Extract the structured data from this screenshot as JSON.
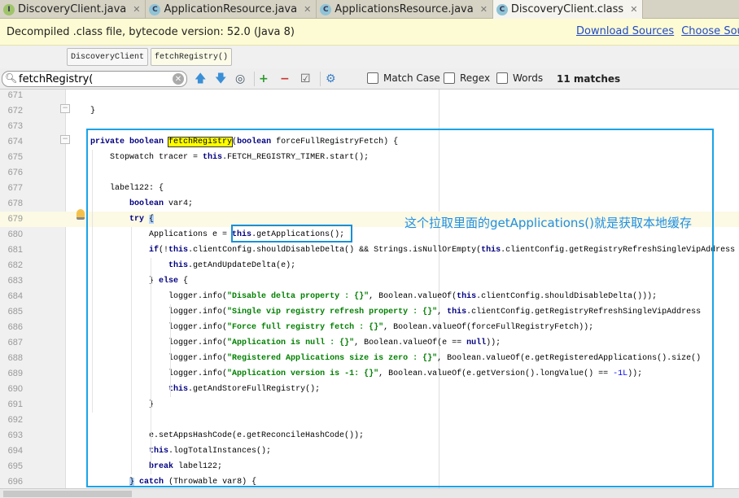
{
  "tabs": [
    {
      "label": "DiscoveryClient.java",
      "icon": "I",
      "type": "interface"
    },
    {
      "label": "ApplicationResource.java",
      "icon": "C",
      "type": "class"
    },
    {
      "label": "ApplicationsResource.java",
      "icon": "C",
      "type": "class"
    },
    {
      "label": "DiscoveryClient.class",
      "icon": "C",
      "type": "class",
      "active": true
    }
  ],
  "banner": {
    "text": "Decompiled .class file, bytecode version: 52.0 (Java 8)",
    "download_sources": "Download Sources",
    "choose_sources": "Choose Sourc"
  },
  "breadcrumb": [
    "DiscoveryClient",
    "fetchRegistry()"
  ],
  "search": {
    "value": "fetchRegistry(",
    "match_case": "Match Case",
    "regex": "Regex",
    "words": "Words",
    "matches": "11 matches"
  },
  "annotation": "这个拉取里面的getApplications()就是获取本地缓存",
  "colors": {
    "keyword": "#000080",
    "string": "#008000",
    "number": "#0000ff",
    "annotation_box": "#1aa3e8",
    "highlight": "#ffff00"
  },
  "code": [
    {
      "n": "671",
      "i": 0,
      "t": []
    },
    {
      "n": "672",
      "i": 1,
      "t": [
        [
          "}",
          ""
        ]
      ]
    },
    {
      "n": "673",
      "i": 0,
      "t": []
    },
    {
      "n": "674",
      "i": 1,
      "t": [
        [
          "private boolean ",
          "kw"
        ],
        [
          "fetchRegistry",
          "hl"
        ],
        [
          "(",
          ""
        ],
        [
          "boolean ",
          "kw"
        ],
        [
          "forceFullRegistryFetch) {",
          ""
        ]
      ]
    },
    {
      "n": "675",
      "i": 2,
      "t": [
        [
          "Stopwatch tracer = ",
          ""
        ],
        [
          "this",
          "kw"
        ],
        [
          ".FETCH_REGISTRY_TIMER.start();",
          ""
        ]
      ]
    },
    {
      "n": "676",
      "i": 0,
      "t": []
    },
    {
      "n": "677",
      "i": 2,
      "t": [
        [
          "label122: {",
          ""
        ]
      ]
    },
    {
      "n": "678",
      "i": 3,
      "t": [
        [
          "boolean ",
          "kw"
        ],
        [
          "var4;",
          ""
        ]
      ]
    },
    {
      "n": "679",
      "i": 3,
      "t": [
        [
          "try ",
          "kw"
        ],
        [
          "{",
          "caret"
        ]
      ],
      "cur": true
    },
    {
      "n": "680",
      "i": 4,
      "t": [
        [
          "Applications e = ",
          ""
        ],
        [
          "this",
          "kw"
        ],
        [
          ".getApplications();",
          ""
        ]
      ]
    },
    {
      "n": "681",
      "i": 4,
      "t": [
        [
          "if",
          "kw"
        ],
        [
          "(!",
          ""
        ],
        [
          "this",
          "kw"
        ],
        [
          ".clientConfig.shouldDisableDelta() && Strings.isNullOrEmpty(",
          ""
        ],
        [
          "this",
          "kw"
        ],
        [
          ".clientConfig.getRegistryRefreshSingleVipAddress",
          ""
        ]
      ]
    },
    {
      "n": "682",
      "i": 5,
      "t": [
        [
          "this",
          "kw"
        ],
        [
          ".getAndUpdateDelta(e);",
          ""
        ]
      ]
    },
    {
      "n": "683",
      "i": 4,
      "t": [
        [
          "} ",
          ""
        ],
        [
          "else ",
          "kw"
        ],
        [
          "{",
          ""
        ]
      ]
    },
    {
      "n": "684",
      "i": 5,
      "t": [
        [
          "logger.info(",
          ""
        ],
        [
          "\"Disable delta property : {}\"",
          "str"
        ],
        [
          ", Boolean.valueOf(",
          ""
        ],
        [
          "this",
          "kw"
        ],
        [
          ".clientConfig.shouldDisableDelta()));",
          ""
        ]
      ]
    },
    {
      "n": "685",
      "i": 5,
      "t": [
        [
          "logger.info(",
          ""
        ],
        [
          "\"Single vip registry refresh property : {}\"",
          "str"
        ],
        [
          ", ",
          ""
        ],
        [
          "this",
          "kw"
        ],
        [
          ".clientConfig.getRegistryRefreshSingleVipAddress",
          ""
        ]
      ]
    },
    {
      "n": "686",
      "i": 5,
      "t": [
        [
          "logger.info(",
          ""
        ],
        [
          "\"Force full registry fetch : {}\"",
          "str"
        ],
        [
          ", Boolean.valueOf(forceFullRegistryFetch));",
          ""
        ]
      ]
    },
    {
      "n": "687",
      "i": 5,
      "t": [
        [
          "logger.info(",
          ""
        ],
        [
          "\"Application is null : {}\"",
          "str"
        ],
        [
          ", Boolean.valueOf(e == ",
          ""
        ],
        [
          "null",
          "kw"
        ],
        [
          "));",
          ""
        ]
      ]
    },
    {
      "n": "688",
      "i": 5,
      "t": [
        [
          "logger.info(",
          ""
        ],
        [
          "\"Registered Applications size is zero : {}\"",
          "str"
        ],
        [
          ", Boolean.valueOf(e.getRegisteredApplications().size()",
          ""
        ]
      ]
    },
    {
      "n": "689",
      "i": 5,
      "t": [
        [
          "logger.info(",
          ""
        ],
        [
          "\"Application version is -1: {}\"",
          "str"
        ],
        [
          ", Boolean.valueOf(e.getVersion().longValue() == ",
          ""
        ],
        [
          "-1L",
          "num"
        ],
        [
          "));",
          ""
        ]
      ]
    },
    {
      "n": "690",
      "i": 5,
      "t": [
        [
          "this",
          "kw"
        ],
        [
          ".getAndStoreFullRegistry();",
          ""
        ]
      ]
    },
    {
      "n": "691",
      "i": 4,
      "t": [
        [
          "}",
          ""
        ]
      ]
    },
    {
      "n": "692",
      "i": 0,
      "t": []
    },
    {
      "n": "693",
      "i": 4,
      "t": [
        [
          "e.setAppsHashCode(e.getReconcileHashCode());",
          ""
        ]
      ]
    },
    {
      "n": "694",
      "i": 4,
      "t": [
        [
          "this",
          "kw"
        ],
        [
          ".logTotalInstances();",
          ""
        ]
      ]
    },
    {
      "n": "695",
      "i": 4,
      "t": [
        [
          "break ",
          "kw"
        ],
        [
          "label122;",
          ""
        ]
      ]
    },
    {
      "n": "696",
      "i": 3,
      "t": [
        [
          "}",
          "caret"
        ],
        [
          " ",
          ""
        ],
        [
          "catch ",
          "kw"
        ],
        [
          "(Throwable var8) {",
          ""
        ]
      ]
    }
  ]
}
